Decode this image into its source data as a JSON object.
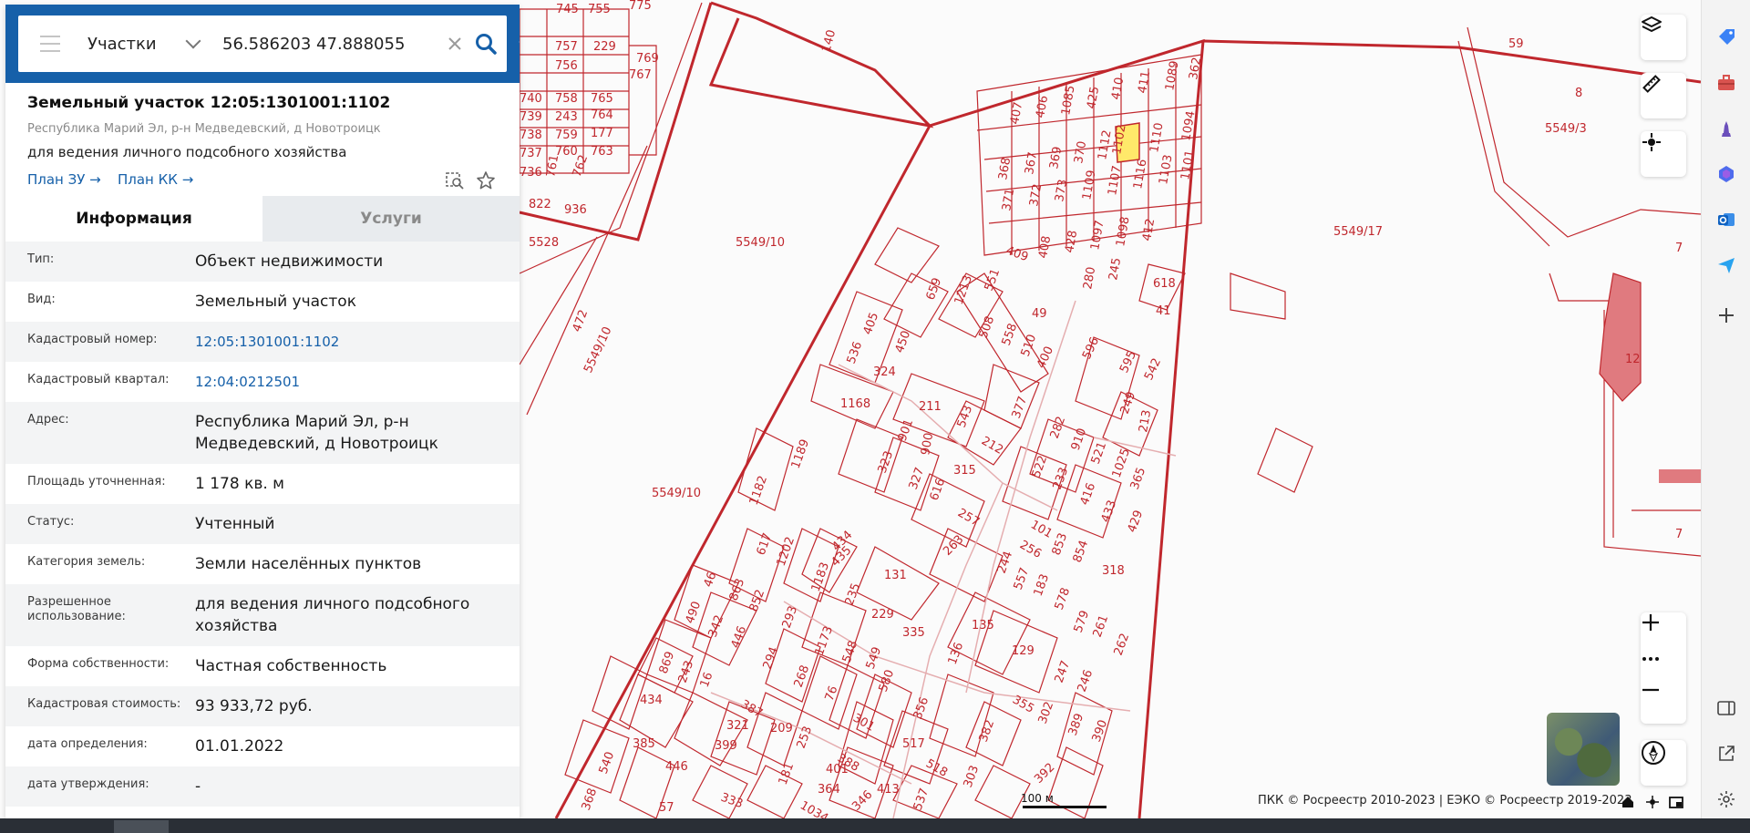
{
  "search": {
    "layer": "Участки",
    "query": "56.586203 47.888055"
  },
  "object": {
    "title": "Земельный участок 12:05:1301001:1102",
    "address": "Республика Марий Эл, р-н Медведевский, д Новотроицк",
    "purpose": "для ведения личного подсобного хозяйства",
    "link_plan_zu": "План ЗУ →",
    "link_plan_kk": "План КК →"
  },
  "tabs": [
    "Информация",
    "Услуги"
  ],
  "info_rows": [
    {
      "label": "Тип:",
      "value": "Объект недвижимости"
    },
    {
      "label": "Вид:",
      "value": "Земельный участок"
    },
    {
      "label": "Кадастровый номер:",
      "value": "12:05:1301001:1102"
    },
    {
      "label": "Кадастровый квартал:",
      "value": "12:04:0212501"
    },
    {
      "label": "Адрес:",
      "value": "Республика Марий Эл, р-н Медведевский, д Новотроицк"
    },
    {
      "label": "Площадь уточненная:",
      "value": "1 178 кв. м"
    },
    {
      "label": "Статус:",
      "value": "Учтенный"
    },
    {
      "label": "Категория земель:",
      "value": "Земли населённых пунктов"
    },
    {
      "label": "Разрешенное использование:",
      "value": "для ведения личного подсобного хозяйства"
    },
    {
      "label": "Форма собственности:",
      "value": "Частная собственность"
    },
    {
      "label": "Кадастровая стоимость:",
      "value": "93 933,72 руб."
    },
    {
      "label": "дата определения:",
      "value": "01.01.2022"
    },
    {
      "label": "дата утверждения:",
      "value": "-"
    }
  ],
  "map_labels": {
    "l1": "5549/10",
    "l2": "5549/10",
    "l3": "5549/10",
    "l4": "5549/17",
    "l5": "5549/3",
    "l6": "5528",
    "l7": "59",
    "l8": "8",
    "l9": "7",
    "l10": "7",
    "l11": "12",
    "l12": "1102",
    "l13": "472",
    "l14": "140",
    "l15": "1168",
    "l16": "315",
    "l17": "1182",
    "l18": "131",
    "l19": "135",
    "l20": "129",
    "l21": "356",
    "l22": "446",
    "l23": "434",
    "l24": "385",
    "l25": "413",
    "l26": "303",
    "l27": "390",
    "l28": "262",
    "l29": "318",
    "l30": "429",
    "l31": "618",
    "l32": "41",
    "l33": "596",
    "l34": "211",
    "l35": "400",
    "l36": "410",
    "l37": "411",
    "l38": "1089",
    "l39": "362",
    "l40": "1094",
    "l41": "1110",
    "l42": "1112",
    "l43": "370",
    "l44": "369",
    "l45": "367",
    "l46": "368",
    "l47": "371",
    "l48": "372",
    "l49": "373",
    "l50": "1109",
    "l51": "1107",
    "l52": "1116",
    "l53": "1103",
    "l54": "1101",
    "l55": "409",
    "l56": "408",
    "l57": "428",
    "l58": "1097",
    "l59": "1098",
    "l60": "412",
    "l61": "757",
    "l62": "229",
    "l63": "769",
    "l64": "756",
    "l65": "767",
    "l66": "740",
    "l67": "758",
    "l68": "765",
    "l69": "739",
    "l70": "243",
    "l71": "764",
    "l72": "738",
    "l73": "759",
    "l74": "177",
    "l75": "737",
    "l76": "760",
    "l77": "763",
    "l78": "736",
    "l79": "761",
    "l80": "762",
    "l81": "822",
    "l82": "936",
    "l83": "405",
    "l84": "450",
    "l85": "536",
    "l86": "324",
    "l87": "659",
    "l88": "1213",
    "l89": "551",
    "l90": "508",
    "l91": "558",
    "l92": "510",
    "l93": "49",
    "l94": "543",
    "l95": "212",
    "l96": "377",
    "l97": "901",
    "l98": "900",
    "l99": "323",
    "l100": "327",
    "l101": "616",
    "l102": "257",
    "l103": "263",
    "l104": "1189",
    "l105": "617",
    "l106": "1202",
    "l107": "434",
    "l108": "435",
    "l109": "1183",
    "l110": "46",
    "l111": "863",
    "l112": "852",
    "l113": "490",
    "l114": "342",
    "l115": "446",
    "l116": "869",
    "l117": "243",
    "l118": "16",
    "l119": "235",
    "l120": "229",
    "l121": "335",
    "l122": "293",
    "l123": "1173",
    "l124": "548",
    "l125": "549",
    "l126": "294",
    "l127": "268",
    "l128": "76",
    "l129": "580",
    "l130": "301",
    "l131": "321",
    "l132": "387",
    "l133": "209",
    "l134": "253",
    "l135": "388",
    "l136": "399",
    "l137": "401",
    "l138": "181",
    "l139": "364",
    "l140": "1034",
    "l141": "346",
    "l142": "517",
    "l143": "518",
    "l144": "136",
    "l145": "382",
    "l146": "355",
    "l147": "302",
    "l148": "389",
    "l149": "392",
    "l150": "101",
    "l151": "256",
    "l152": "853",
    "l153": "854",
    "l154": "183",
    "l155": "578",
    "l156": "579",
    "l157": "261",
    "l158": "244",
    "l159": "557",
    "l160": "247",
    "l161": "246",
    "l162": "522",
    "l163": "233",
    "l164": "282",
    "l165": "910",
    "l166": "521",
    "l167": "1025",
    "l168": "416",
    "l169": "433",
    "l170": "365",
    "l171": "249",
    "l172": "213",
    "l173": "595",
    "l174": "542",
    "l175": "280",
    "l176": "245",
    "l177": "407",
    "l178": "406",
    "l179": "1085",
    "l180": "425",
    "l181": "57",
    "l182": "333",
    "l183": "368",
    "l184": "540",
    "l185": "537",
    "l186": "745",
    "l187": "755",
    "l188": "775"
  },
  "map": {
    "scale": "100 м",
    "attribution": "ПКК © Росреестр 2010-2023 | ЕЭКО © Росреестр 2019-2023"
  },
  "colors": {
    "panel_header": "#1660a9",
    "link": "#1660a9",
    "parcel_line": "#c0272d",
    "selected_parcel": "#ffe96a",
    "fill_zone": "#e07a7f"
  }
}
